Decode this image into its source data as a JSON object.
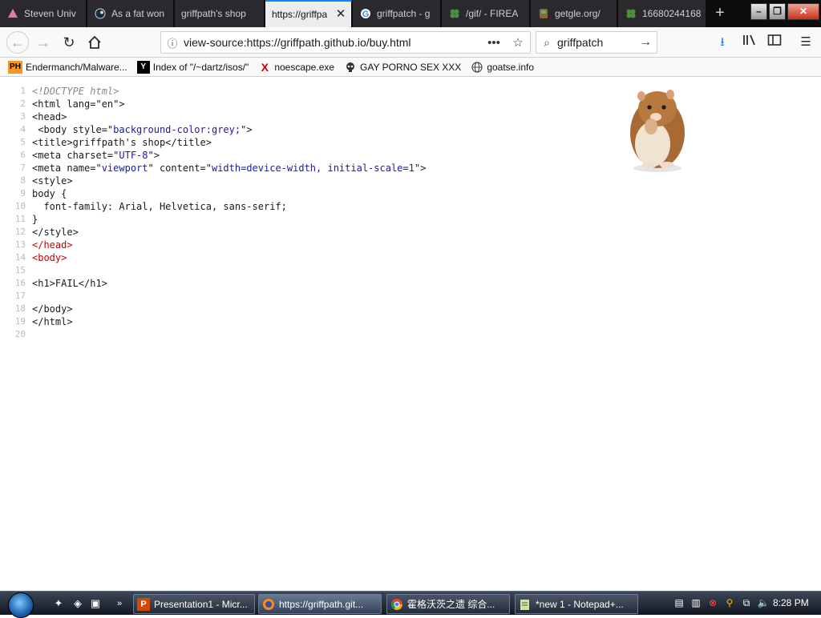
{
  "colors": {
    "tab_accent": "#0a84ff",
    "taskbar": "#1c2230",
    "source_attr_value": "#1a1aa6",
    "source_error": "#cc0000"
  },
  "tabs": [
    {
      "label": "Steven Univ",
      "icon": "steven-universe-icon"
    },
    {
      "label": "As a fat won",
      "icon": "steam-icon"
    },
    {
      "label": "griffpath's shop",
      "icon": "page-icon"
    },
    {
      "label": "https://griffpa",
      "icon": "page-icon",
      "active": true
    },
    {
      "label": "griffpatch - g",
      "icon": "google-icon"
    },
    {
      "label": "/gif/ - FIREA",
      "icon": "clover-icon"
    },
    {
      "label": "getgle.org/",
      "icon": "getgle-icon"
    },
    {
      "label": "16680244168",
      "icon": "clover-icon"
    }
  ],
  "navbar": {
    "url": "view-source:https://griffpath.github.io/buy.html",
    "search_value": "griffpatch"
  },
  "bookmarks": [
    {
      "label": "Endermanch/Malware...",
      "icon": "PH"
    },
    {
      "label": "Index of \"/~dartz/isos/\"",
      "icon": "Y"
    },
    {
      "label": "noescape.exe",
      "icon": "X"
    },
    {
      "label": "GAY PORNO SEX XXX",
      "icon": "skull"
    },
    {
      "label": "goatse.info",
      "icon": "globe"
    }
  ],
  "source": {
    "line_numbers": [
      "1",
      "2",
      "3",
      "4",
      "5",
      "6",
      "7",
      "8",
      "9",
      "10",
      "11",
      "12",
      "13",
      "14",
      "15",
      "16",
      "17",
      "18",
      "19",
      "20"
    ],
    "l1": "<!DOCTYPE html>",
    "l2": "<html lang=\"en\">",
    "l3": "<head>",
    "l4_a": " <body style=\"",
    "l4_b": "background-color:grey;",
    "l4_c": "\">",
    "l5": "<title>griffpath's shop</title>",
    "l6_a": "<meta charset=\"",
    "l6_b": "UTF-8",
    "l6_c": "\">",
    "l7_a": "<meta name=\"",
    "l7_b": "viewport",
    "l7_c": "\" content=\"",
    "l7_d": "width=device-width, initial-scale=1",
    "l7_e": "\">",
    "l8": "<style>",
    "l9": "body {",
    "l10": "  font-family: Arial, Helvetica, sans-serif;",
    "l11": "}",
    "l12": "</style>",
    "l13": "</head>",
    "l14": "<body>",
    "l15": "",
    "l16": "<h1>FAIL</h1>",
    "l17": "",
    "l18": "</body>",
    "l19": "</html>",
    "l20": ""
  },
  "taskbar": {
    "buttons": [
      {
        "label": "Presentation1 - Micr...",
        "icon": "powerpoint-icon"
      },
      {
        "label": "https://griffpath.git...",
        "icon": "firefox-icon",
        "active": true
      },
      {
        "label": "霍格沃茨之遗 综合...",
        "icon": "chrome-icon"
      },
      {
        "label": "*new 1 - Notepad+...",
        "icon": "notepad-icon"
      }
    ],
    "clock": "8:28 PM"
  }
}
